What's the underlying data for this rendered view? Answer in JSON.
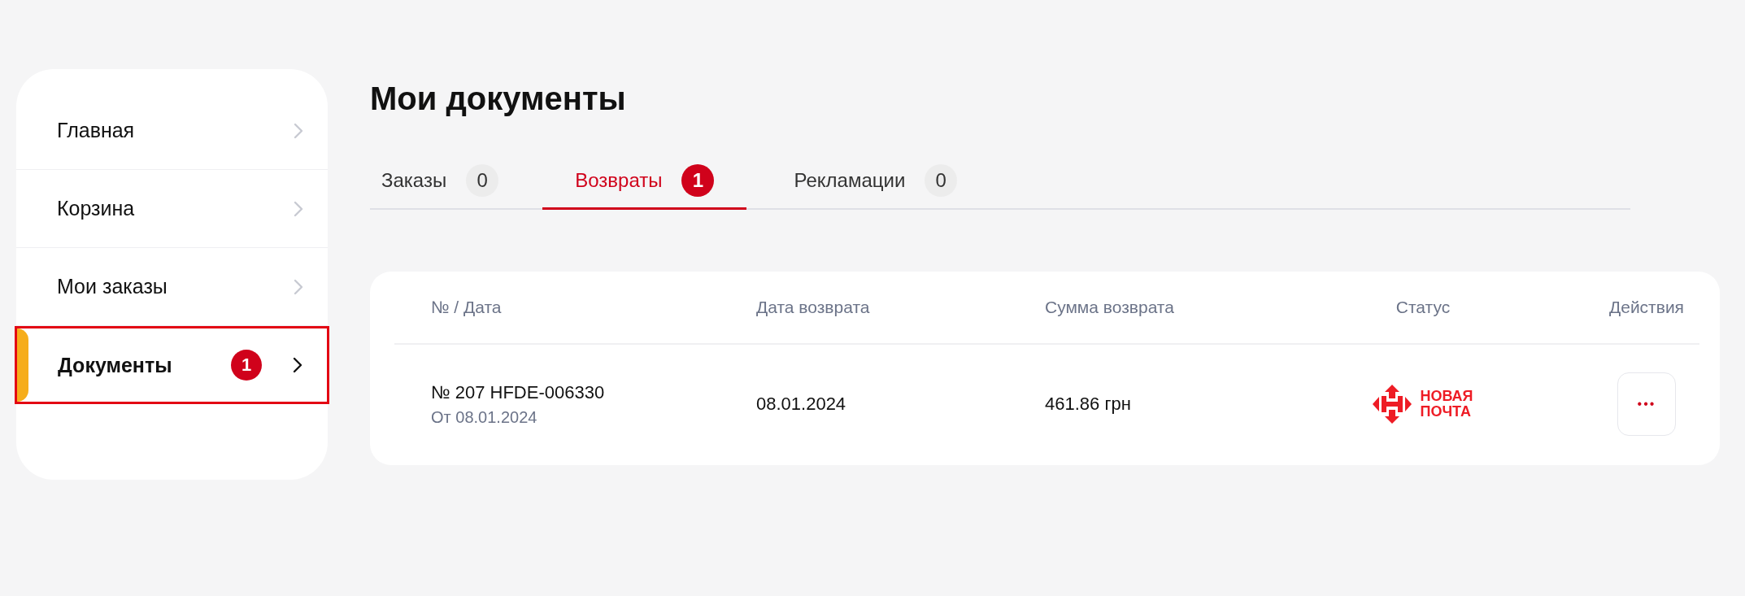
{
  "sidebar": {
    "items": [
      {
        "label": "Главная",
        "selected": false,
        "highlighted": false
      },
      {
        "label": "Корзина",
        "selected": false,
        "highlighted": false
      },
      {
        "label": "Мои заказы",
        "selected": false,
        "highlighted": false
      },
      {
        "label": "Документы",
        "selected": true,
        "highlighted": true,
        "badge": "1"
      }
    ]
  },
  "title": "Мои документы",
  "tabs": [
    {
      "label": "Заказы",
      "count": "0",
      "selected": false
    },
    {
      "label": "Возвраты",
      "count": "1",
      "selected": true
    },
    {
      "label": "Рекламации",
      "count": "0",
      "selected": false
    }
  ],
  "table": {
    "columns": [
      "№ / Дата",
      "Дата возврата",
      "Сумма возврата",
      "Статус",
      "Действия"
    ],
    "rows": [
      {
        "number": "№ 207 HFDE-006330",
        "date_from": "От 08.01.2024",
        "return_date": "08.01.2024",
        "amount": "461.86 грн",
        "status": {
          "kind": "carrier",
          "line_1": "НОВАЯ",
          "line_2": "ПОЧТА"
        },
        "action": "•••"
      }
    ]
  }
}
